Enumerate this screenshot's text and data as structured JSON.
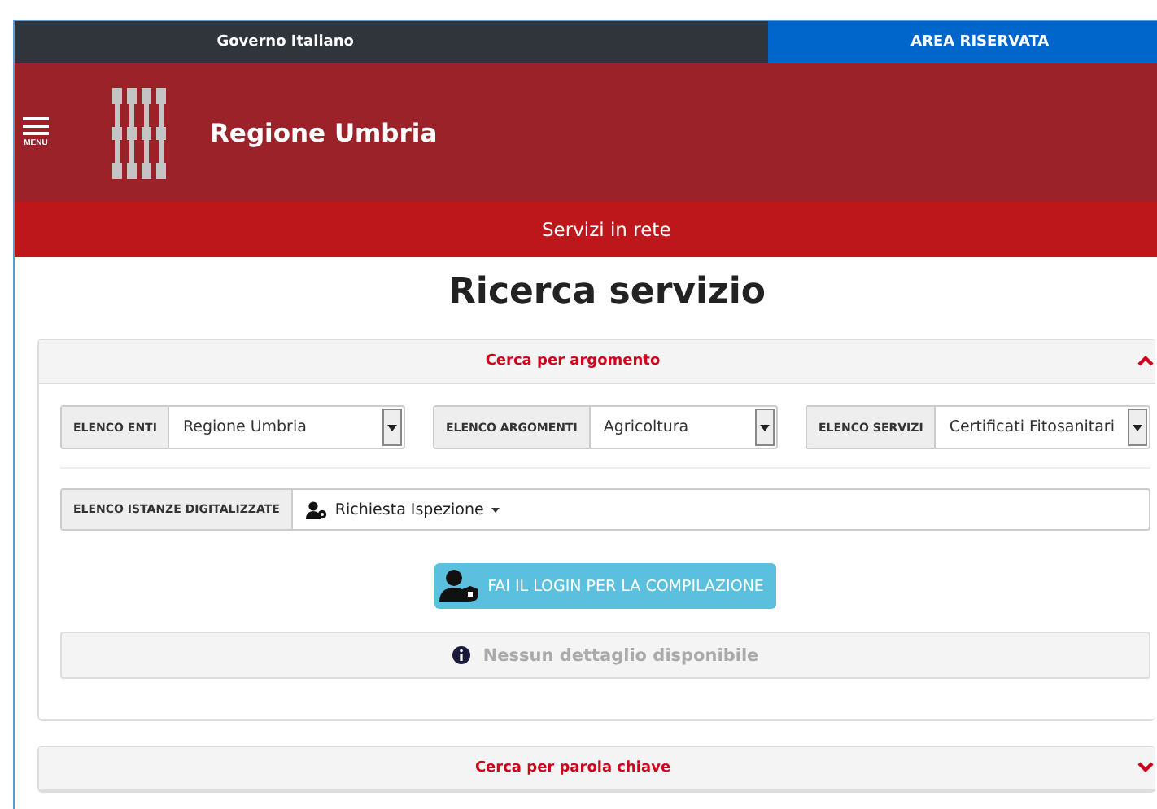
{
  "top_bar": {
    "left": "Governo Italiano",
    "right": "AREA RISERVATA"
  },
  "header": {
    "menu_label": "MENU",
    "title": "Regione Umbria"
  },
  "nav": {
    "label": "Servizi in rete"
  },
  "page_title": "Ricerca servizio",
  "panels": [
    {
      "title": "Cerca per argomento",
      "expanded": true,
      "selects": [
        {
          "label": "ELENCO ENTI",
          "value": "Regione Umbria"
        },
        {
          "label": "ELENCO ARGOMENTI",
          "value": "Agricoltura"
        },
        {
          "label": "ELENCO SERVIZI",
          "value": "Certificati Fitosanitari"
        }
      ],
      "instances": {
        "label": "ELENCO ISTANZE DIGITALIZZATE",
        "value": "Richiesta Ispezione"
      },
      "login_button": "FAI IL LOGIN PER LA COMPILAZIONE",
      "info": "Nessun dettaglio disponibile"
    },
    {
      "title": "Cerca per parola chiave",
      "expanded": false
    }
  ]
}
